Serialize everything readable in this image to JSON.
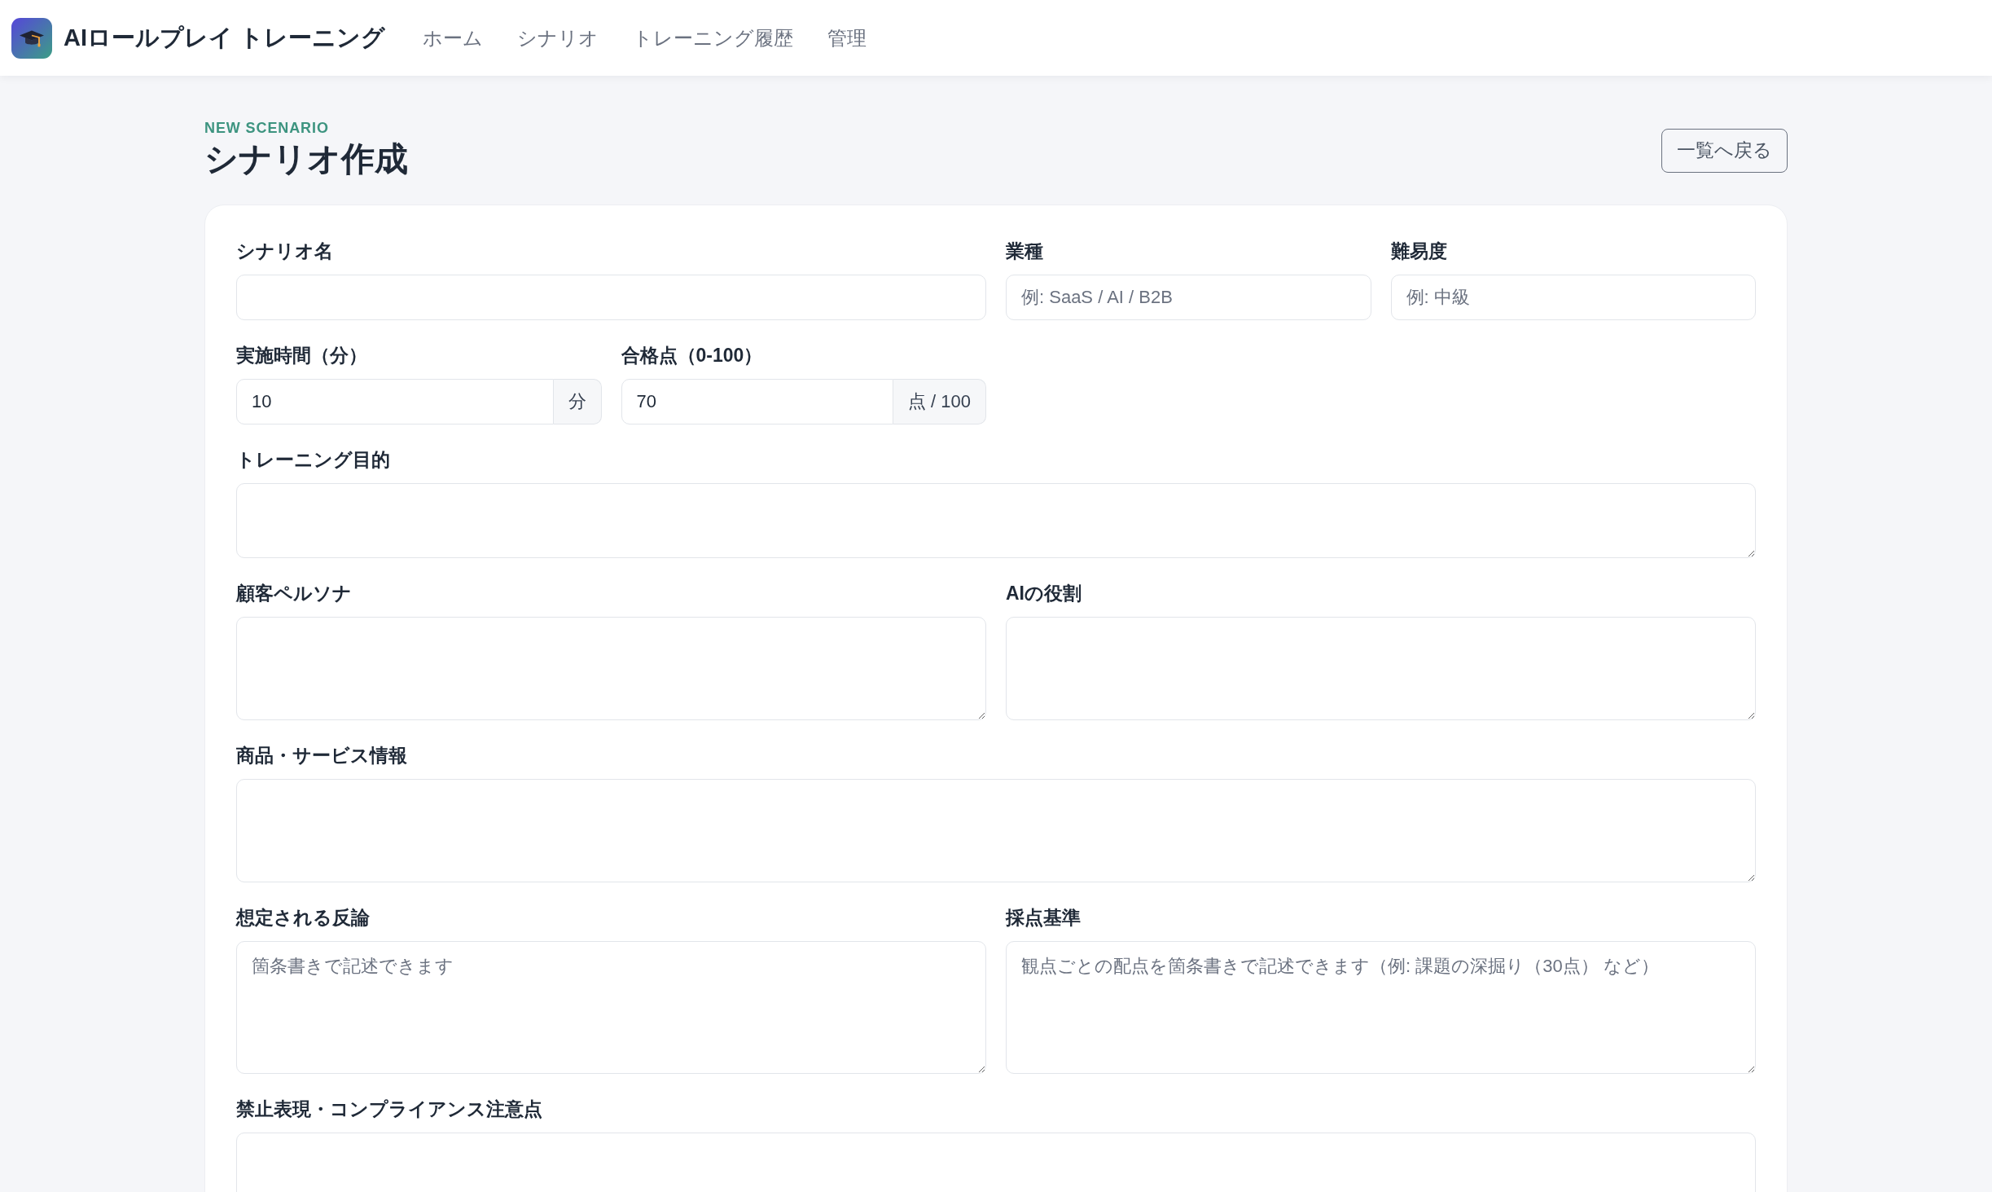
{
  "header": {
    "brand": "AIロールプレイ トレーニング",
    "nav": [
      {
        "label": "ホーム"
      },
      {
        "label": "シナリオ"
      },
      {
        "label": "トレーニング履歴"
      },
      {
        "label": "管理"
      }
    ]
  },
  "page": {
    "eyebrow": "NEW SCENARIO",
    "title": "シナリオ作成",
    "back_button": "一覧へ戻る"
  },
  "form": {
    "rows": [
      {
        "fields": [
          {
            "kind": "input",
            "label": "シナリオ名"
          },
          {
            "kind": "input",
            "label": "業種",
            "placeholder": "例: SaaS / AI / B2B"
          },
          {
            "kind": "input",
            "label": "難易度",
            "placeholder": "例: 中級"
          }
        ]
      },
      {
        "fields": [
          {
            "kind": "addon",
            "label": "実施時間（分）",
            "value": "10",
            "unit": "分"
          },
          {
            "kind": "addon",
            "label": "合格点（0-100）",
            "value": "70",
            "unit": "点 / 100"
          }
        ]
      },
      {
        "fields": [
          {
            "kind": "textarea",
            "label": "トレーニング目的"
          }
        ]
      },
      {
        "fields": [
          {
            "kind": "textarea",
            "label": "顧客ペルソナ"
          },
          {
            "kind": "textarea",
            "label": "AIの役割"
          }
        ]
      },
      {
        "fields": [
          {
            "kind": "textarea",
            "label": "商品・サービス情報"
          }
        ]
      },
      {
        "fields": [
          {
            "kind": "textarea",
            "label": "想定される反論",
            "placeholder": "箇条書きで記述できます"
          },
          {
            "kind": "textarea",
            "label": "採点基準",
            "placeholder": "観点ごとの配点を箇条書きで記述できます（例: 課題の深掘り（30点） など）"
          }
        ]
      },
      {
        "fields": [
          {
            "kind": "textarea",
            "label": "禁止表現・コンプライアンス注意点"
          }
        ]
      }
    ]
  }
}
